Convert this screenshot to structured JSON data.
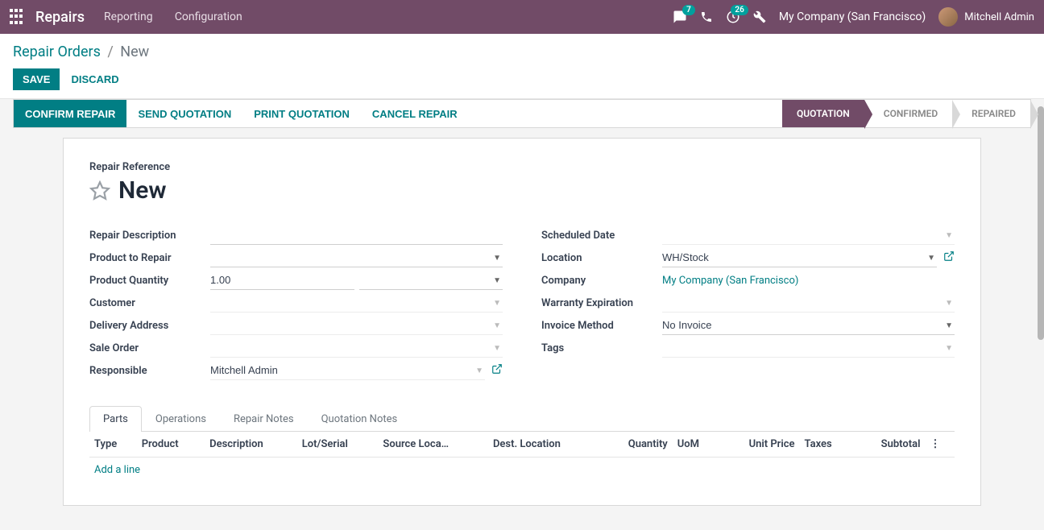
{
  "topbar": {
    "brand": "Repairs",
    "menu": [
      "Reporting",
      "Configuration"
    ],
    "messages_badge": "7",
    "activities_badge": "26",
    "company": "My Company (San Francisco)",
    "user": "Mitchell Admin"
  },
  "breadcrumb": {
    "root": "Repair Orders",
    "current": "New"
  },
  "subhead_actions": {
    "save": "SAVE",
    "discard": "DISCARD"
  },
  "actions": {
    "confirm": "CONFIRM REPAIR",
    "send_quotation": "SEND QUOTATION",
    "print_quotation": "PRINT QUOTATION",
    "cancel": "CANCEL REPAIR"
  },
  "stages": {
    "quotation": "QUOTATION",
    "confirmed": "CONFIRMED",
    "repaired": "REPAIRED",
    "active": "quotation"
  },
  "form": {
    "repair_reference_label": "Repair Reference",
    "repair_reference": "New",
    "left": {
      "repair_description": {
        "label": "Repair Description",
        "value": ""
      },
      "product_to_repair": {
        "label": "Product to Repair",
        "value": ""
      },
      "product_quantity": {
        "label": "Product Quantity",
        "value": "1.00",
        "uom": ""
      },
      "customer": {
        "label": "Customer",
        "value": ""
      },
      "delivery_address": {
        "label": "Delivery Address",
        "value": ""
      },
      "sale_order": {
        "label": "Sale Order",
        "value": ""
      },
      "responsible": {
        "label": "Responsible",
        "value": "Mitchell Admin"
      }
    },
    "right": {
      "scheduled_date": {
        "label": "Scheduled Date",
        "value": ""
      },
      "location": {
        "label": "Location",
        "value": "WH/Stock"
      },
      "company": {
        "label": "Company",
        "value": "My Company (San Francisco)"
      },
      "warranty_expiration": {
        "label": "Warranty Expiration",
        "value": ""
      },
      "invoice_method": {
        "label": "Invoice Method",
        "value": "No Invoice"
      },
      "tags": {
        "label": "Tags",
        "value": ""
      }
    }
  },
  "tabs": {
    "items": [
      "Parts",
      "Operations",
      "Repair Notes",
      "Quotation Notes"
    ],
    "active": 0
  },
  "parts_table": {
    "columns": [
      "Type",
      "Product",
      "Description",
      "Lot/Serial",
      "Source Loca…",
      "Dest. Location",
      "Quantity",
      "UoM",
      "Unit Price",
      "Taxes",
      "Subtotal"
    ],
    "add_line": "Add a line",
    "rows": []
  }
}
